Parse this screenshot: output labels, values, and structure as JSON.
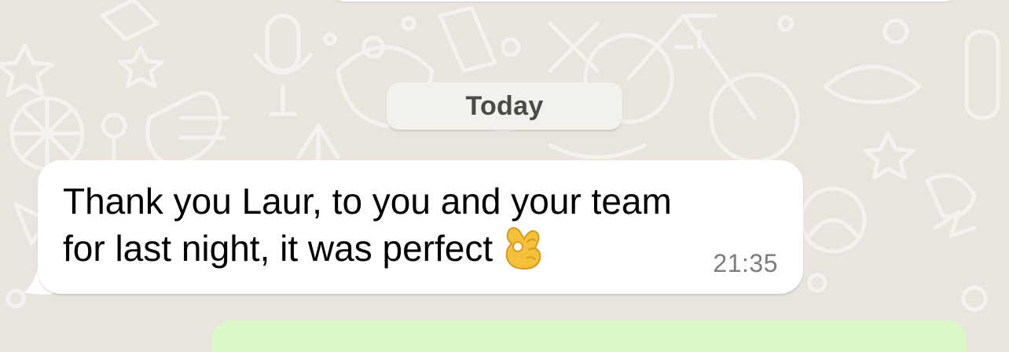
{
  "chat": {
    "date_separator": "Today",
    "message": {
      "line1": "Thank you Laur, to you and your team",
      "line2": "for last night, it was perfect",
      "emoji": "ok-hand-emoji",
      "time": "21:35",
      "direction": "incoming"
    }
  },
  "colors": {
    "wallpaper": "#e9e5de",
    "incoming_bubble": "#ffffff",
    "outgoing_bubble": "#dcf8c6",
    "date_pill": "#f3f1ec",
    "timestamp": "#7c7c7c"
  }
}
